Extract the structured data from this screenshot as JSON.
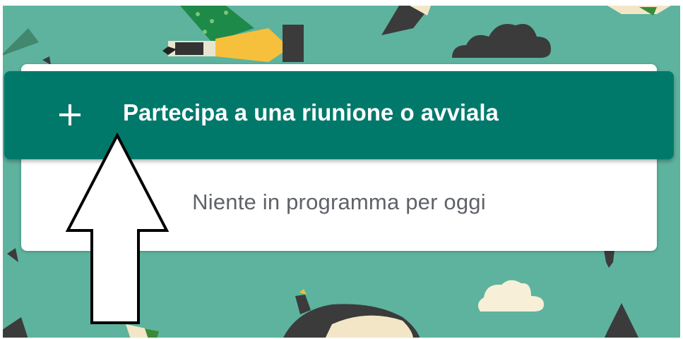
{
  "join_button": {
    "icon": "plus-icon",
    "label": "Partecipa a una riunione o avviala"
  },
  "schedule_card": {
    "empty_message": "Niente in programma per oggi"
  },
  "annotation": {
    "icon": "up-arrow-annotation"
  },
  "colors": {
    "background": "#5db39e",
    "button": "#00796b",
    "card": "#ffffff",
    "empty_text": "#5f6368"
  }
}
